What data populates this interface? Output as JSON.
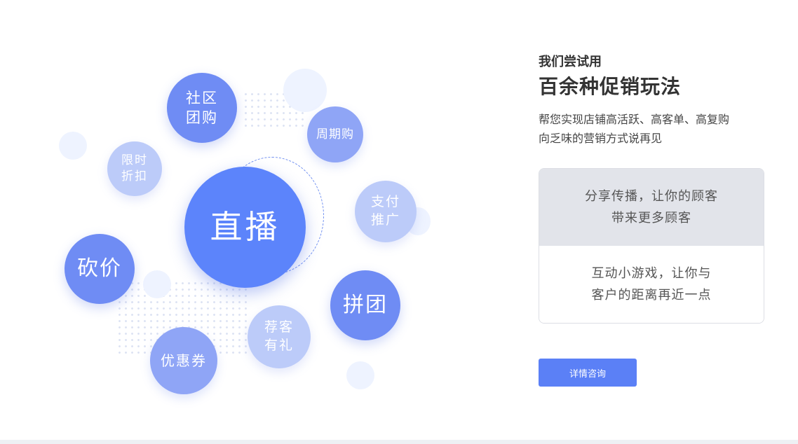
{
  "bubbles": {
    "shequ": [
      "社区",
      "团购"
    ],
    "zhouqi": [
      "周期购"
    ],
    "xianshi": [
      "限时",
      "折扣"
    ],
    "zhibo": [
      "直播"
    ],
    "zhifu": [
      "支付",
      "推广"
    ],
    "kanjia": [
      "砍价"
    ],
    "pintuan": [
      "拼团"
    ],
    "jianke": [
      "荐客",
      "有礼"
    ],
    "youhui": [
      "优惠券"
    ]
  },
  "intro": {
    "pre_title": "我们尝试用",
    "title": "百余种促销玩法",
    "desc_line1": "帮您实现店铺高活跃、高客单、高复购",
    "desc_line2": "向乏味的营销方式说再见"
  },
  "features": [
    {
      "line1": "分享传播，让你的顾客",
      "line2": "带来更多顾客",
      "active": true
    },
    {
      "line1": "互动小游戏，让你与",
      "line2": "客户的距离再近一点",
      "active": false
    }
  ],
  "cta": {
    "label": "详情咨询"
  },
  "colors": {
    "primary": "#5b80f6",
    "bubble_dark": "#6f8cf4",
    "bubble_mid": "#8fa5f6",
    "bubble_light": "#bccbf9",
    "card_active_bg": "#e2e4ea"
  }
}
